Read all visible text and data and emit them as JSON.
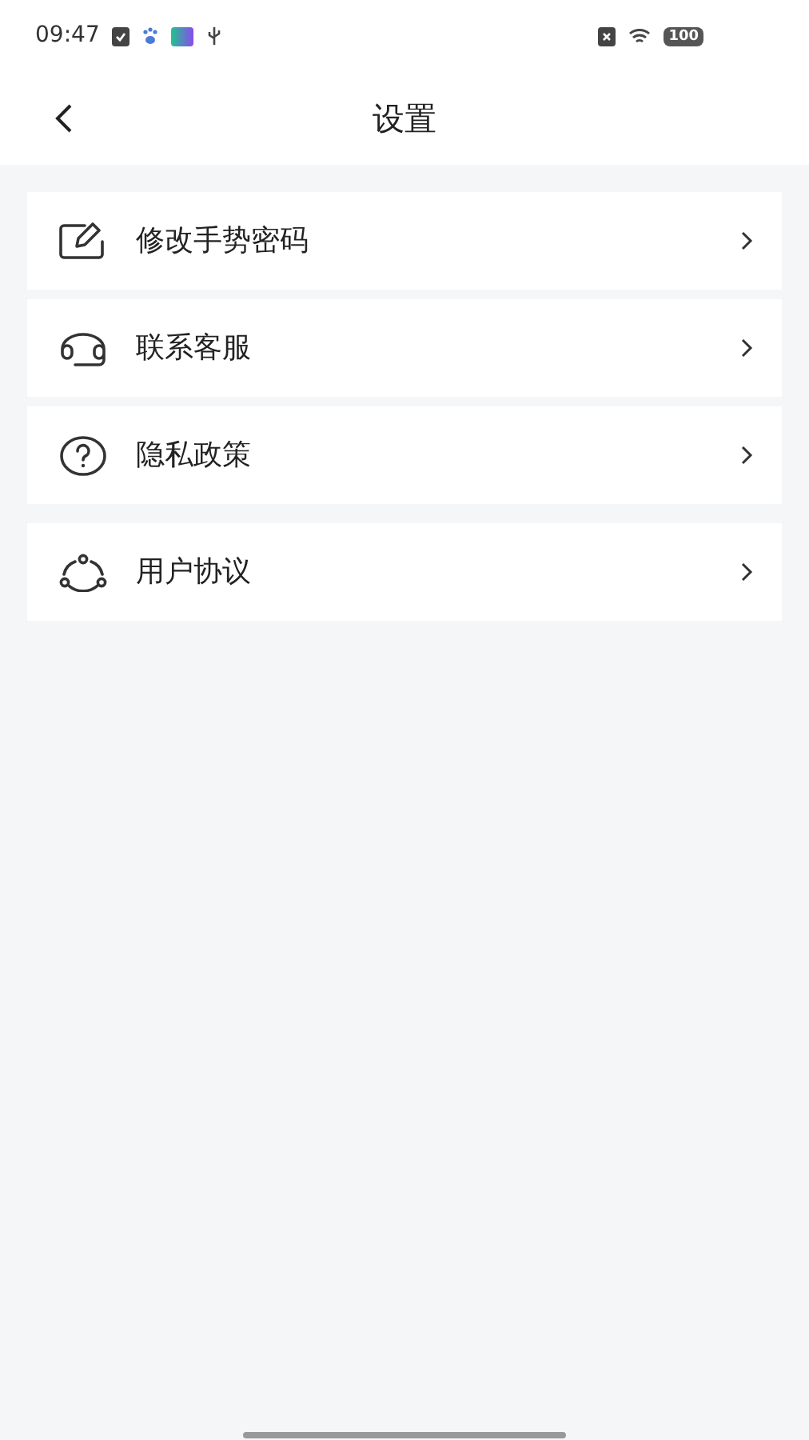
{
  "status_bar": {
    "time": "09:47",
    "battery": "100"
  },
  "header": {
    "title": "设置"
  },
  "sections": [
    {
      "items": [
        {
          "kind": "edit",
          "label": "修改手势密码"
        },
        {
          "kind": "headset",
          "label": "联系客服"
        },
        {
          "kind": "help",
          "label": "隐私政策"
        }
      ]
    },
    {
      "items": [
        {
          "kind": "share",
          "label": "用户协议"
        }
      ]
    }
  ]
}
